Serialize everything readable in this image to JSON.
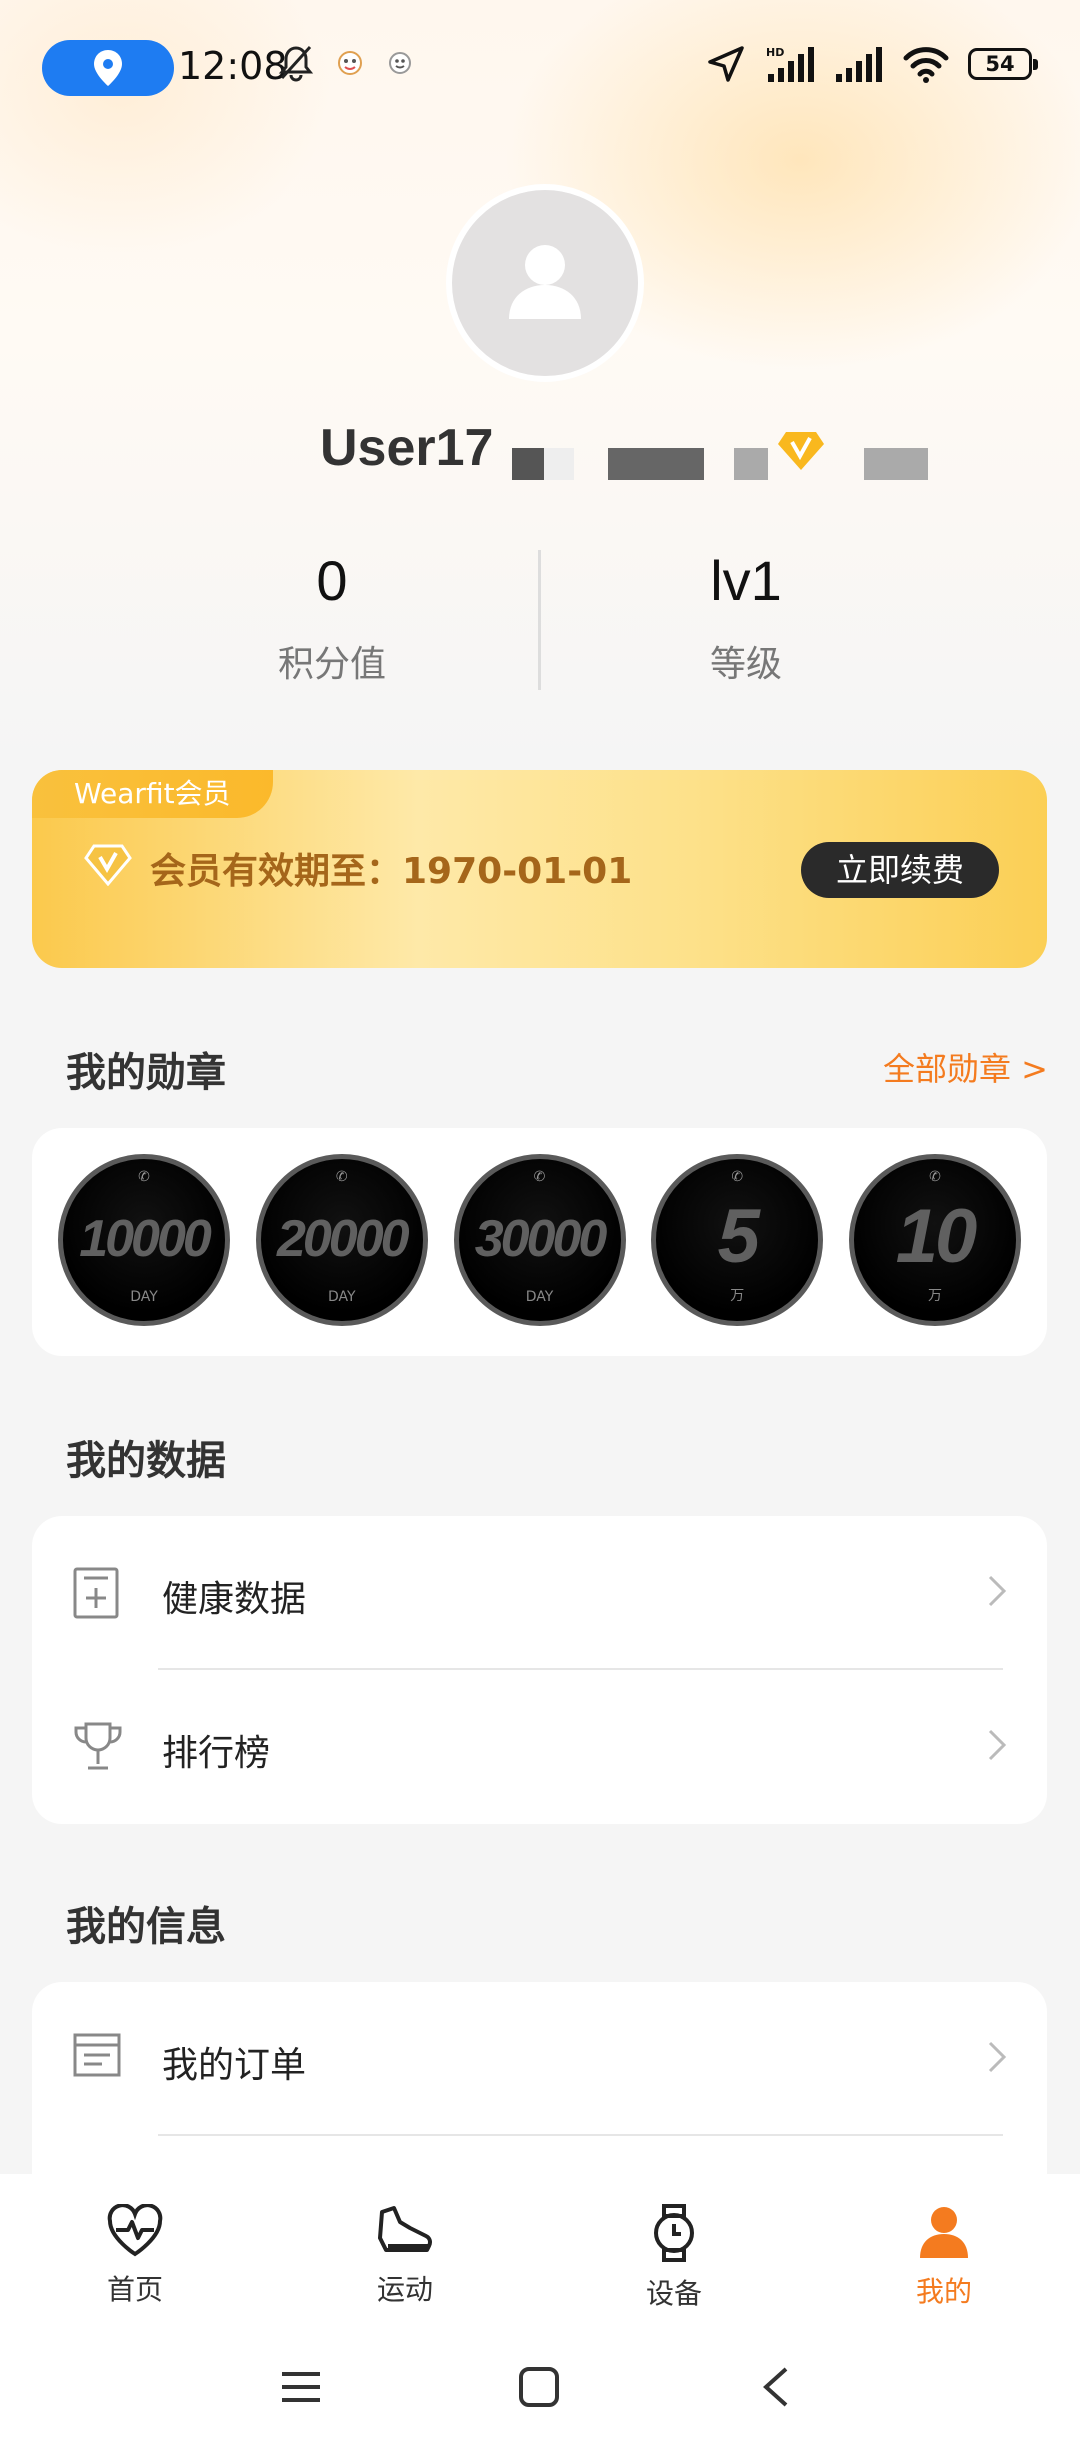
{
  "status_bar": {
    "time": "12:08",
    "battery": "54",
    "network_label": "HD"
  },
  "profile": {
    "username": "User17",
    "points_value": "0",
    "points_label": "积分值",
    "level_value": "lv1",
    "level_label": "等级"
  },
  "membership": {
    "tag": "Wearfit会员",
    "validity": "会员有效期至：1970-01-01",
    "renew_label": "立即续费"
  },
  "badges_section": {
    "title": "我的勋章",
    "all_link": "全部勋章 >",
    "badges": [
      {
        "number": "10000",
        "unit": "DAY"
      },
      {
        "number": "20000",
        "unit": "DAY"
      },
      {
        "number": "30000",
        "unit": "DAY"
      },
      {
        "number": "5",
        "unit": "万"
      },
      {
        "number": "10",
        "unit": "万"
      }
    ]
  },
  "data_section": {
    "title": "我的数据",
    "items": [
      {
        "label": "健康数据",
        "icon": "health-data-icon"
      },
      {
        "label": "排行榜",
        "icon": "trophy-icon"
      }
    ]
  },
  "info_section": {
    "title": "我的信息",
    "items": [
      {
        "label": "我的订单",
        "icon": "order-icon"
      }
    ]
  },
  "bottom_nav": {
    "items": [
      {
        "label": "首页",
        "icon": "heart-pulse-icon"
      },
      {
        "label": "运动",
        "icon": "shoe-icon"
      },
      {
        "label": "设备",
        "icon": "watch-icon"
      },
      {
        "label": "我的",
        "icon": "person-icon",
        "active": true
      }
    ]
  },
  "colors": {
    "accent": "#f47b1f",
    "location_pill": "#1e7cf2",
    "member_text": "#a5661a"
  }
}
